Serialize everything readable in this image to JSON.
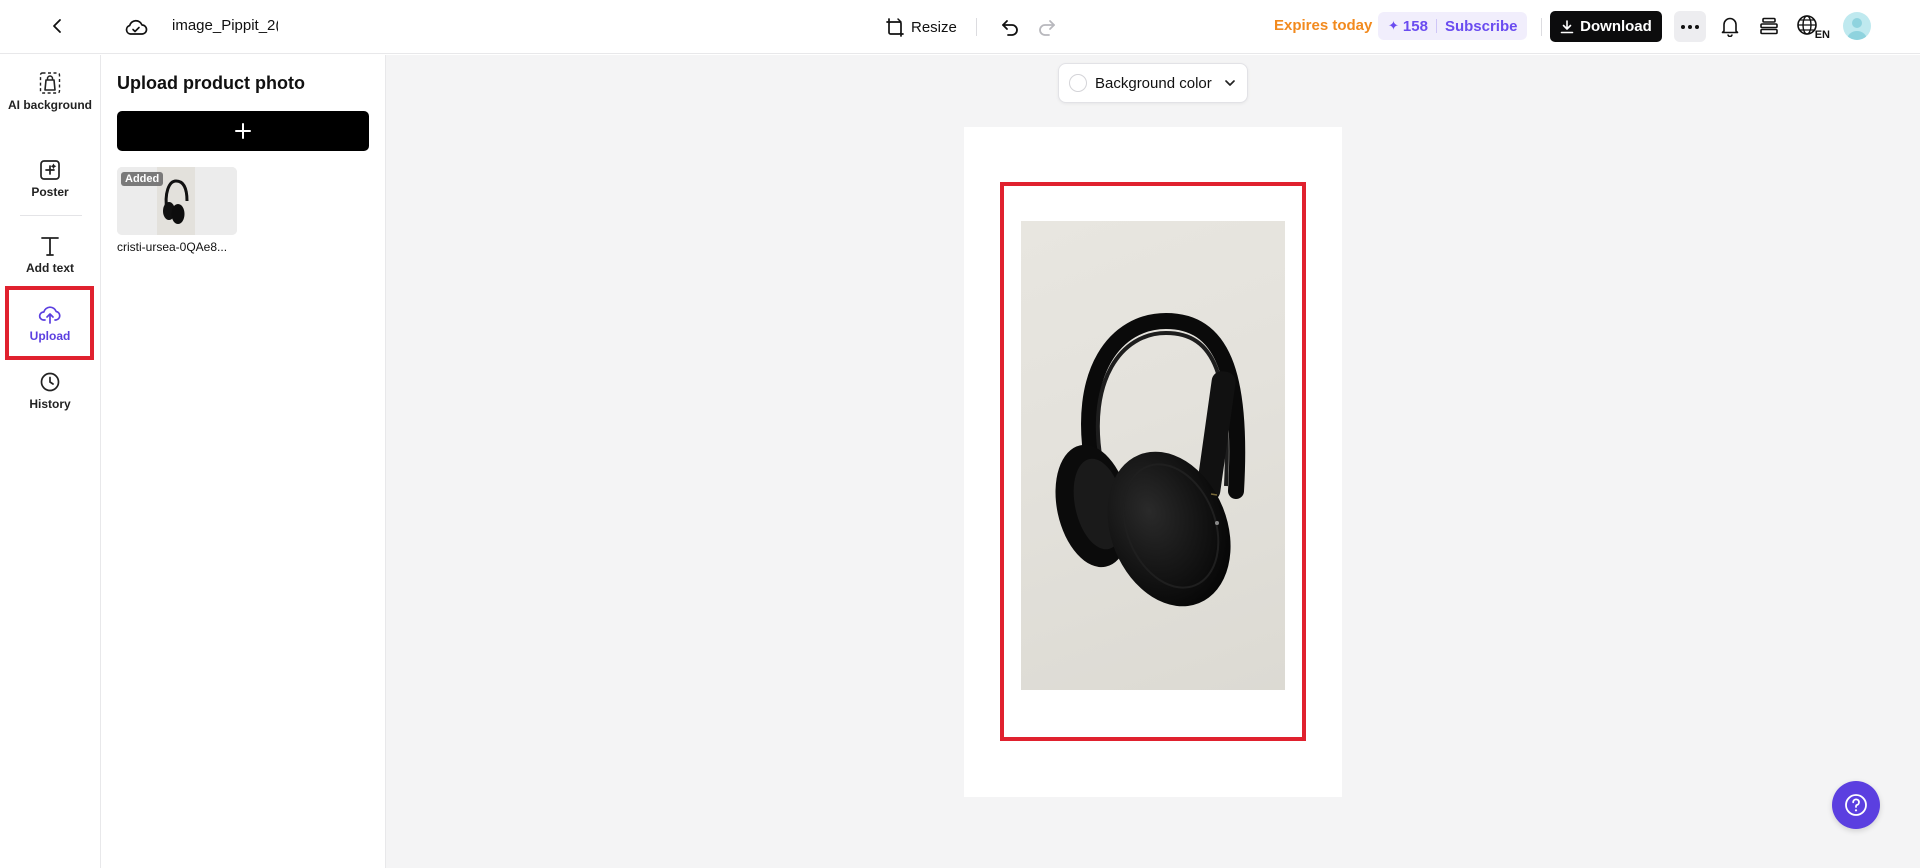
{
  "header": {
    "filename": "image_Pippit_2(",
    "resize_label": "Resize",
    "expires_label": "Expires today",
    "credits": "158",
    "subscribe_label": "Subscribe",
    "download_label": "Download",
    "language": "EN"
  },
  "sidebar": {
    "items": [
      {
        "label": "AI background",
        "icon": "ai-background-icon"
      },
      {
        "label": "Poster",
        "icon": "poster-icon"
      },
      {
        "label": "Add text",
        "icon": "text-icon"
      },
      {
        "label": "Upload",
        "icon": "upload-cloud-icon",
        "active": true
      },
      {
        "label": "History",
        "icon": "clock-icon"
      }
    ]
  },
  "panel": {
    "title": "Upload product photo",
    "uploads": [
      {
        "badge": "Added",
        "name": "cristi-ursea-0QAe8..."
      }
    ]
  },
  "canvas": {
    "bg_color_label": "Background color"
  },
  "colors": {
    "accent": "#5b3fe0",
    "expires": "#f28a1e",
    "highlight": "#e0212e"
  }
}
